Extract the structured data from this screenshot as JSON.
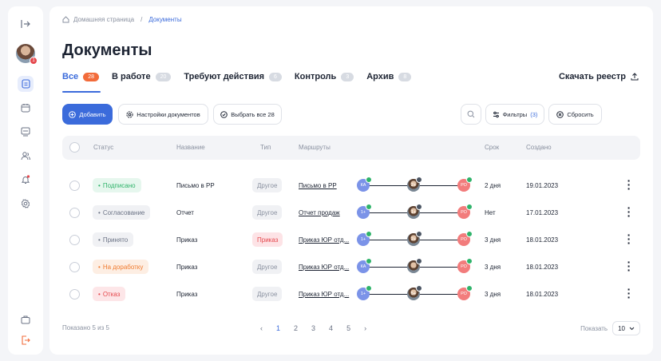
{
  "sidebar": {
    "icons": [
      "expand-icon",
      "avatar",
      "documents-icon",
      "calendar-icon",
      "monitor-icon",
      "users-icon",
      "bell-icon",
      "settings-icon",
      "briefcase-icon",
      "logout-icon"
    ],
    "avatar_badge": "1"
  },
  "breadcrumb": {
    "home": "Домашняя страница",
    "separator": "/",
    "current": "Документы"
  },
  "page_title": "Документы",
  "tabs": [
    {
      "label": "Все",
      "count": "28"
    },
    {
      "label": "В работе",
      "count": "20"
    },
    {
      "label": "Требуют действия",
      "count": "6"
    },
    {
      "label": "Контроль",
      "count": "3"
    },
    {
      "label": "Архив",
      "count": "8"
    }
  ],
  "download_label": "Скачать реестр",
  "toolbar": {
    "add": "Добавить",
    "settings": "Настройки документов",
    "select_all": "Выбрать все 28",
    "filters": "Фильтры",
    "filters_count": "(3)",
    "reset": "Сбросить"
  },
  "table": {
    "headers": [
      "Статус",
      "Название",
      "Тип",
      "Маршруты",
      "Срок",
      "Создано"
    ],
    "rows": [
      {
        "status": "Подписано",
        "status_color": "#2fb36a",
        "status_bg": "#e6f7ee",
        "name": "Письмо в РР",
        "type": "Другое",
        "type_red": false,
        "route": "Письмо в РР",
        "term": "2 дня",
        "created": "19.01.2023",
        "n1": "КА",
        "n2": "2+",
        "n3": "РО"
      },
      {
        "status": "Согласование",
        "status_color": "#6b7385",
        "status_bg": "#f0f1f4",
        "name": "Отчет",
        "type": "Другое",
        "type_red": false,
        "route": "Отчет продаж",
        "term": "Нет",
        "created": "17.01.2023",
        "n1": "1+",
        "n2": "1+",
        "n3": "РО"
      },
      {
        "status": "Принято",
        "status_color": "#6b7385",
        "status_bg": "#f0f1f4",
        "name": "Приказ",
        "type": "Приказ",
        "type_red": true,
        "route": "Приказ ЮР отд...",
        "term": "3 дня",
        "created": "18.01.2023",
        "n1": "1+",
        "n2": "2+",
        "n3": "РО"
      },
      {
        "status": "На доработку",
        "status_color": "#f07a2e",
        "status_bg": "#fdeee3",
        "name": "Приказ",
        "type": "Другое",
        "type_red": false,
        "route": "Приказ ЮР отд...",
        "term": "3 дня",
        "created": "18.01.2023",
        "n1": "КА",
        "n2": "",
        "n3": "РО"
      },
      {
        "status": "Отказ",
        "status_color": "#e5484d",
        "status_bg": "#fde6e8",
        "name": "Приказ",
        "type": "Другое",
        "type_red": false,
        "route": "Приказ ЮР отд...",
        "term": "3 дня",
        "created": "18.01.2023",
        "n1": "1+",
        "n2": "5+",
        "n3": "РО"
      }
    ]
  },
  "footer": {
    "shown": "Показано 5 из 5",
    "pages": [
      "1",
      "2",
      "3",
      "4",
      "5"
    ],
    "current_page": "1",
    "per_page_label": "Показать",
    "per_page_value": "10"
  }
}
